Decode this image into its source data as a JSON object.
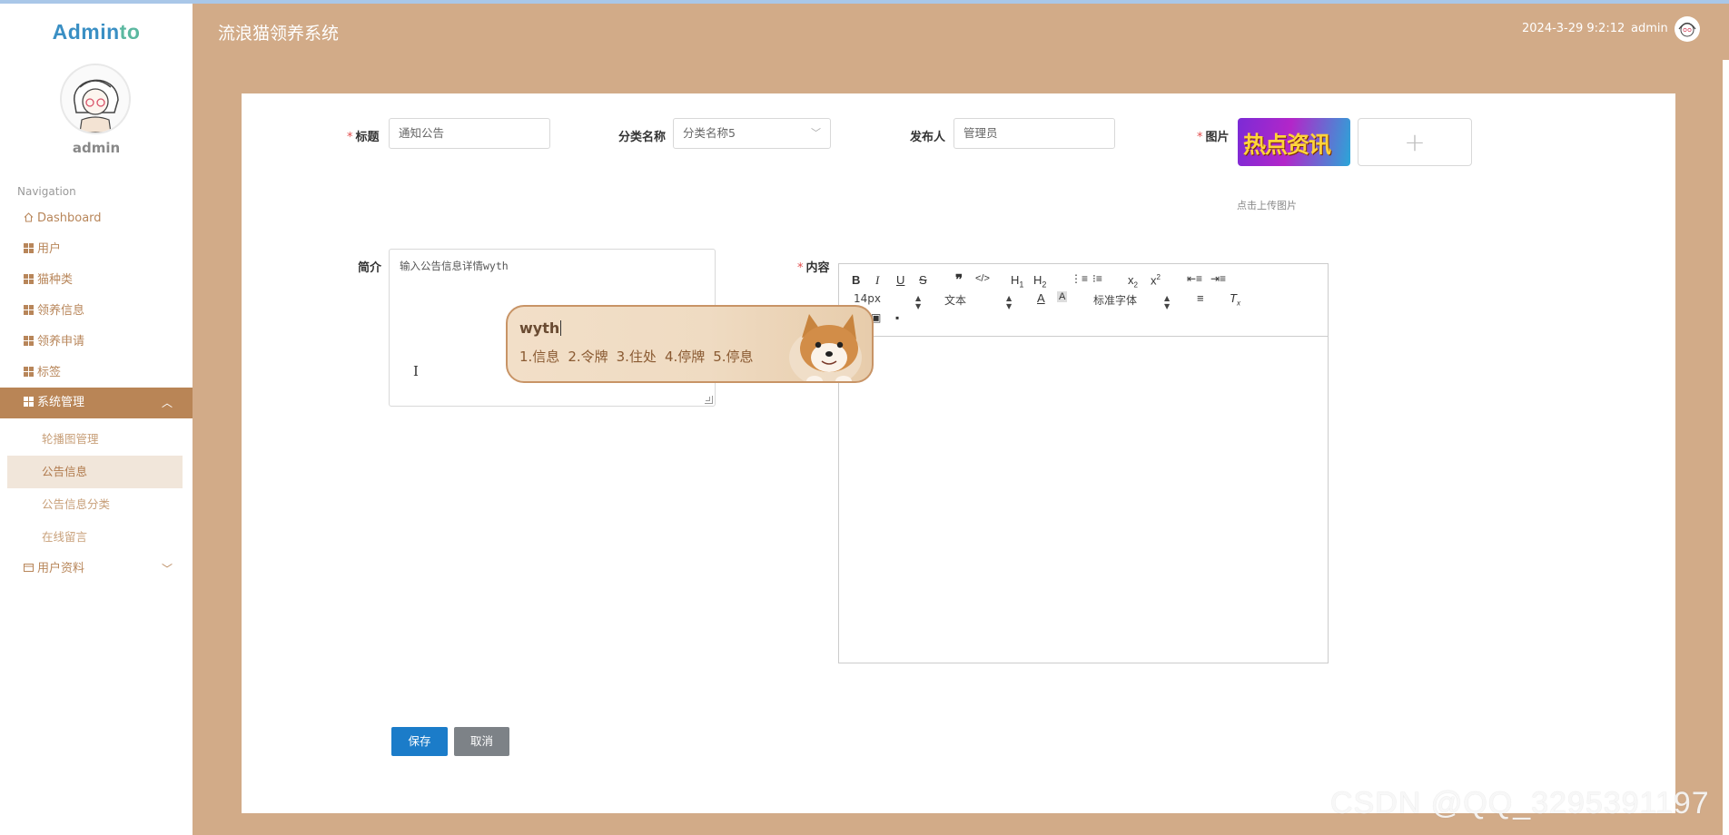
{
  "brand": {
    "name_a": "Admin",
    "name_b": "to"
  },
  "sidebar": {
    "username": "admin",
    "nav_title": "Navigation",
    "items": [
      {
        "label": "Dashboard"
      },
      {
        "label": "用户"
      },
      {
        "label": "猫种类"
      },
      {
        "label": "领养信息"
      },
      {
        "label": "领养申请"
      },
      {
        "label": "标签"
      },
      {
        "label": "系统管理"
      },
      {
        "label": "用户资料"
      }
    ],
    "sub_items": [
      {
        "label": "轮播图管理"
      },
      {
        "label": "公告信息"
      },
      {
        "label": "公告信息分类"
      },
      {
        "label": "在线留言"
      }
    ]
  },
  "header": {
    "title": "流浪猫领养系统",
    "datetime": "2024-3-29 9:2:12",
    "user": "admin"
  },
  "form": {
    "title_label": "标题",
    "title_value": "通知公告",
    "category_label": "分类名称",
    "category_value": "分类名称5",
    "publisher_label": "发布人",
    "publisher_value": "管理员",
    "image_label": "图片",
    "image_text": "热点资讯",
    "upload_plus": "+",
    "upload_tip": "点击上传图片",
    "intro_label": "简介",
    "intro_value": "输入公告信息详情wyth",
    "content_label": "内容",
    "save_label": "保存",
    "cancel_label": "取消"
  },
  "editor": {
    "font_size": "14px",
    "text_type": "文本",
    "font_family": "标准字体"
  },
  "ime": {
    "input": "wyth",
    "candidates": [
      "1.信息",
      "2.令牌",
      "3.住处",
      "4.停牌",
      "5.停息"
    ]
  },
  "watermark": "CSDN @QQ_3295391197",
  "colors": {
    "header_bg": "#d2ab88",
    "sidebar_active": "#b98556",
    "primary": "#1b7cc9"
  }
}
